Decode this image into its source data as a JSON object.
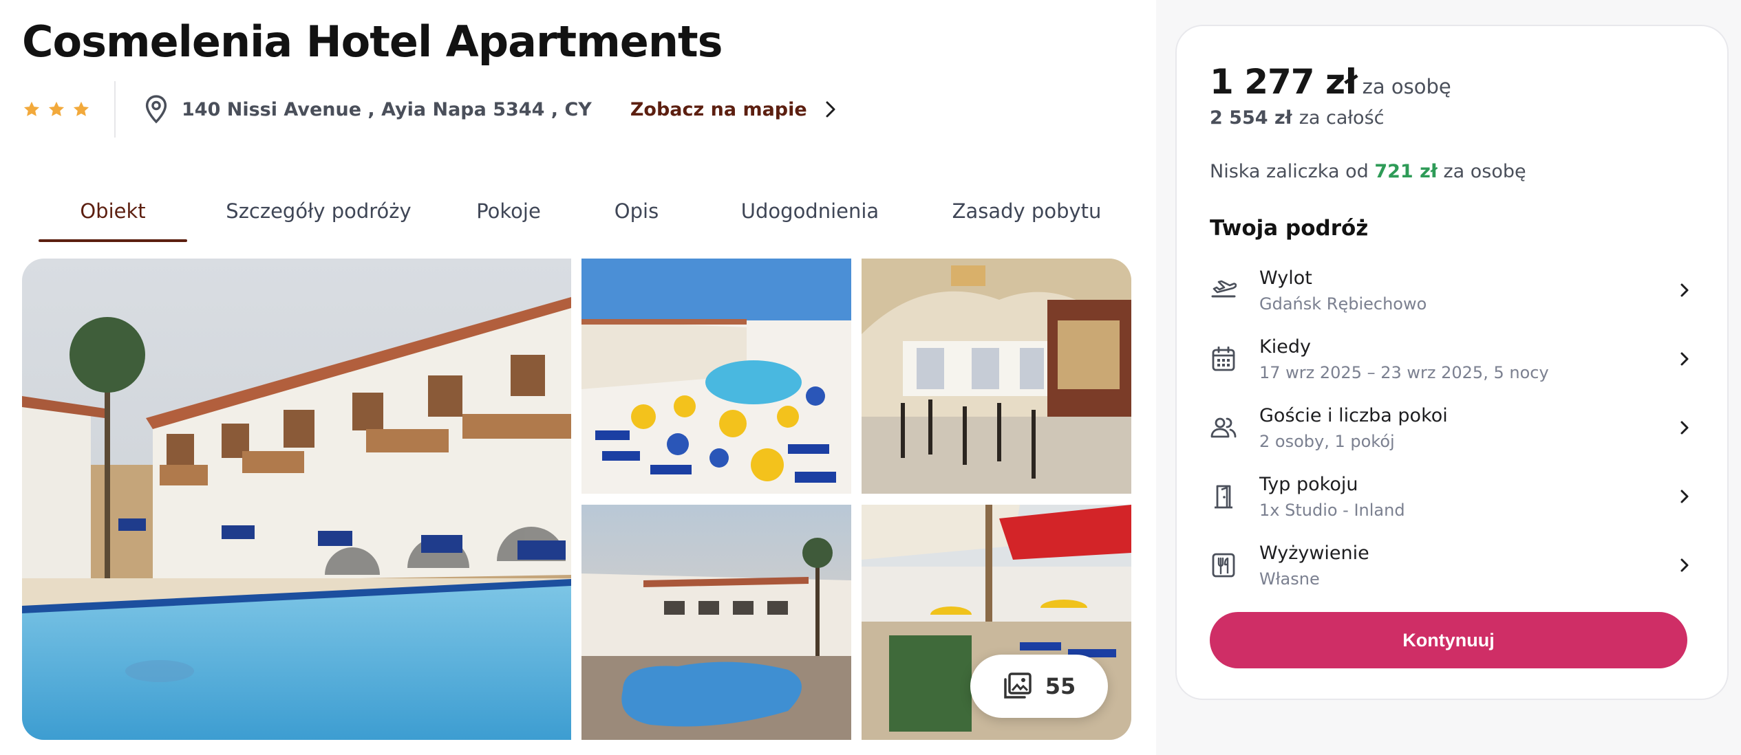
{
  "hotel": {
    "name": "Cosmelenia Hotel Apartments",
    "stars": 3,
    "address": "140 Nissi Avenue , Ayia Napa 5344 , CY",
    "map_link": "Zobacz na mapie"
  },
  "tabs": [
    {
      "label": "Obiekt",
      "active": true
    },
    {
      "label": "Szczegóły podróży",
      "active": false
    },
    {
      "label": "Pokoje",
      "active": false
    },
    {
      "label": "Opis",
      "active": false
    },
    {
      "label": "Udogodnienia",
      "active": false
    },
    {
      "label": "Zasady pobytu",
      "active": false
    }
  ],
  "gallery": {
    "photo_count": "55",
    "photos": [
      "hotel-pool-main",
      "pool-umbrellas-aerial",
      "bar-interior",
      "pool-evening",
      "terrace-coca-cola"
    ]
  },
  "booking": {
    "price_per_person": "1 277 zł",
    "per_person_label": "za osobę",
    "price_total": "2 554 zł",
    "total_label": "za całość",
    "deposit_prefix": "Niska zaliczka od",
    "deposit_amount": "721 zł",
    "deposit_suffix": "za osobę",
    "trip_heading": "Twoja podróż",
    "rows": [
      {
        "label": "Wylot",
        "value": "Gdańsk Rębiechowo",
        "icon": "plane-departure-icon"
      },
      {
        "label": "Kiedy",
        "value": "17 wrz 2025 – 23 wrz 2025, 5 nocy",
        "icon": "calendar-icon"
      },
      {
        "label": "Goście i liczba pokoi",
        "value": "2 osoby, 1 pokój",
        "icon": "guests-icon"
      },
      {
        "label": "Typ pokoju",
        "value": "1x Studio - Inland",
        "icon": "door-icon"
      },
      {
        "label": "Wyżywienie",
        "value": "Własne",
        "icon": "meal-icon"
      }
    ],
    "continue_label": "Kontynuuj"
  },
  "colors": {
    "star": "#f2a93b",
    "accent_brown": "#5c1f10",
    "cta_pink": "#cf2e66",
    "deposit_green": "#2e9b57"
  }
}
